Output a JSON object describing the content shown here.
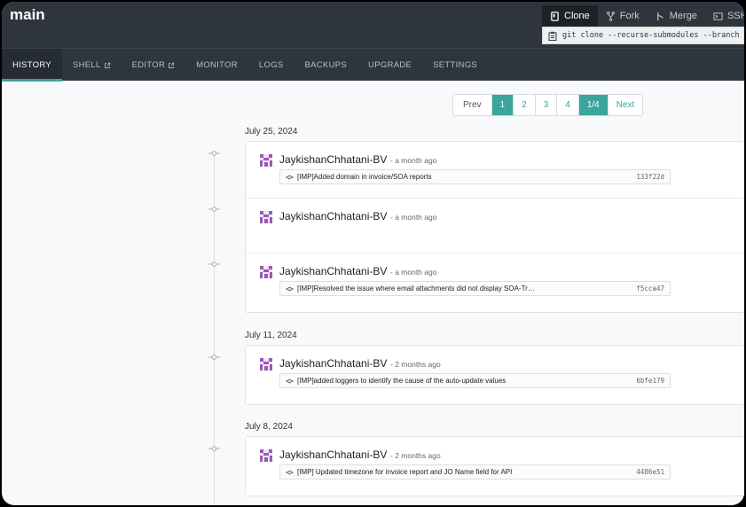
{
  "repo": {
    "branch": "main"
  },
  "git_actions": {
    "clone": "Clone",
    "fork": "Fork",
    "merge": "Merge",
    "ssh": "SSH",
    "clone_command": "git clone --recurse-submodules --branch main"
  },
  "tabs": [
    {
      "label": "HISTORY",
      "active": true,
      "external": false
    },
    {
      "label": "SHELL",
      "active": false,
      "external": true
    },
    {
      "label": "EDITOR",
      "active": false,
      "external": true
    },
    {
      "label": "MONITOR",
      "active": false,
      "external": false
    },
    {
      "label": "LOGS",
      "active": false,
      "external": false
    },
    {
      "label": "BACKUPS",
      "active": false,
      "external": false
    },
    {
      "label": "UPGRADE",
      "active": false,
      "external": false
    },
    {
      "label": "SETTINGS",
      "active": false,
      "external": false
    }
  ],
  "pagination": {
    "prev": "Prev",
    "pages": [
      "1",
      "2",
      "3",
      "4"
    ],
    "current": "1",
    "status": "1/4",
    "next": "Next"
  },
  "groups": [
    {
      "date": "July 25, 2024",
      "commits": [
        {
          "author": "JaykishanChhatani-BV",
          "ago": "a month ago",
          "message": "[IMP]Added domain in invoice/SOA reports",
          "sha": "133f22d"
        },
        {
          "author": "JaykishanChhatani-BV",
          "ago": "a month ago",
          "message": "",
          "sha": ""
        },
        {
          "author": "JaykishanChhatani-BV",
          "ago": "a month ago",
          "message": "[IMP]Resolved the issue where email attachments did not display SOA-Tr…",
          "sha": "f5cca47"
        }
      ]
    },
    {
      "date": "July 11, 2024",
      "commits": [
        {
          "author": "JaykishanChhatani-BV",
          "ago": "2 months ago",
          "message": "[IMP]added loggers to identify the cause of the auto-update values",
          "sha": "6bfe179"
        }
      ]
    },
    {
      "date": "July 8, 2024",
      "commits": [
        {
          "author": "JaykishanChhatani-BV",
          "ago": "2 months ago",
          "message": "[IMP] Updated timezone for invoice report and JO Name field for API",
          "sha": "4486e51"
        }
      ]
    }
  ],
  "colors": {
    "accent": "#3aa59a",
    "header": "#2e353d",
    "avatar": "#9b59b6"
  }
}
